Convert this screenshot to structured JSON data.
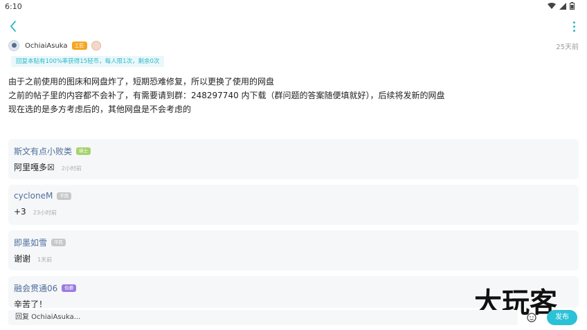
{
  "status_bar": {
    "time": "6:10"
  },
  "post": {
    "author": "OchiaiAsuka",
    "level_badge": "工匠",
    "time": "25天前",
    "reward_notice": "回复本贴有100%率获得15轻币，每人限1次，剩余0次",
    "content": [
      "由于之前使用的图床和网盘炸了，短期恐难修复，所以更换了使用的网盘",
      "之前的帖子里的内容都不会补了，有需要请到群：248297740 内下载（群问题的答案随便填就好），后续将发新的网盘",
      "现在选的是多方考虑后的，其他网盘是不会考虑的"
    ]
  },
  "comments": [
    {
      "name": "斯文有点小败类",
      "badge": "骑士",
      "badge_color": "#a6d36d",
      "text": "阿里嘎多☒",
      "time": "2小时前"
    },
    {
      "name": "cycloneM",
      "badge": "平民",
      "badge_color": "#c8c8c8",
      "text": "+3",
      "time": "23小时前"
    },
    {
      "name": "即墨如雪",
      "badge": "平民",
      "badge_color": "#c8c8c8",
      "text": "谢谢",
      "time": "1天前"
    },
    {
      "name": "融会贯通06",
      "badge": "伯爵",
      "badge_color": "#9b7be0",
      "text": "辛苦了！",
      "time": ""
    }
  ],
  "bottom": {
    "reply_placeholder": "回复 OchiaiAsuka...",
    "publish_label": "发布"
  },
  "watermark": "大玩客",
  "colors": {
    "accent": "#2bb8c8",
    "name_blue": "#4c6e9a",
    "level_orange": "#f5a623"
  }
}
